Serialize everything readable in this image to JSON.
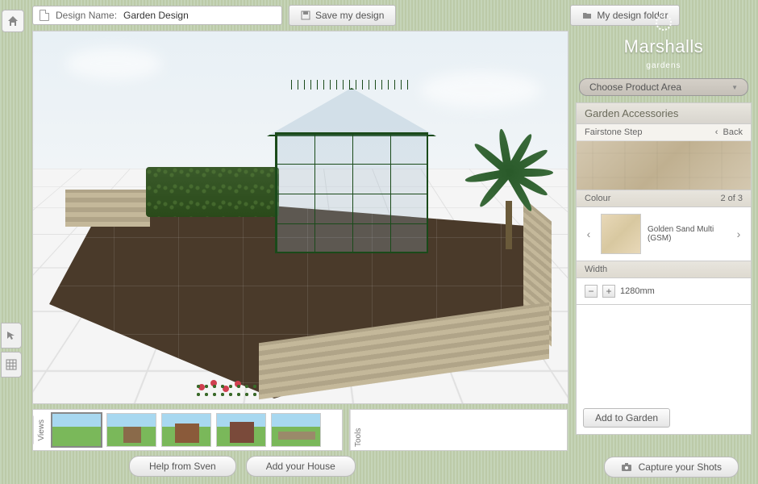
{
  "topbar": {
    "design_name_label": "Design Name:",
    "design_name_value": "Garden Design",
    "save_label": "Save my design",
    "folder_label": "My design folder"
  },
  "brand": {
    "name": "Marshalls",
    "sub": "gardens"
  },
  "product_dropdown": "Choose Product Area",
  "sidebar": {
    "category": "Garden Accessories",
    "product": "Fairstone Step",
    "back": "Back",
    "colour_label": "Colour",
    "colour_index": "2 of 3",
    "colour_name": "Golden Sand Multi (GSM)",
    "width_label": "Width",
    "width_value": "1280mm",
    "add_label": "Add to Garden"
  },
  "bottom": {
    "views_label": "Views",
    "tools_label": "Tools"
  },
  "footer": {
    "help": "Help from Sven",
    "house": "Add your House",
    "capture": "Capture your Shots"
  }
}
